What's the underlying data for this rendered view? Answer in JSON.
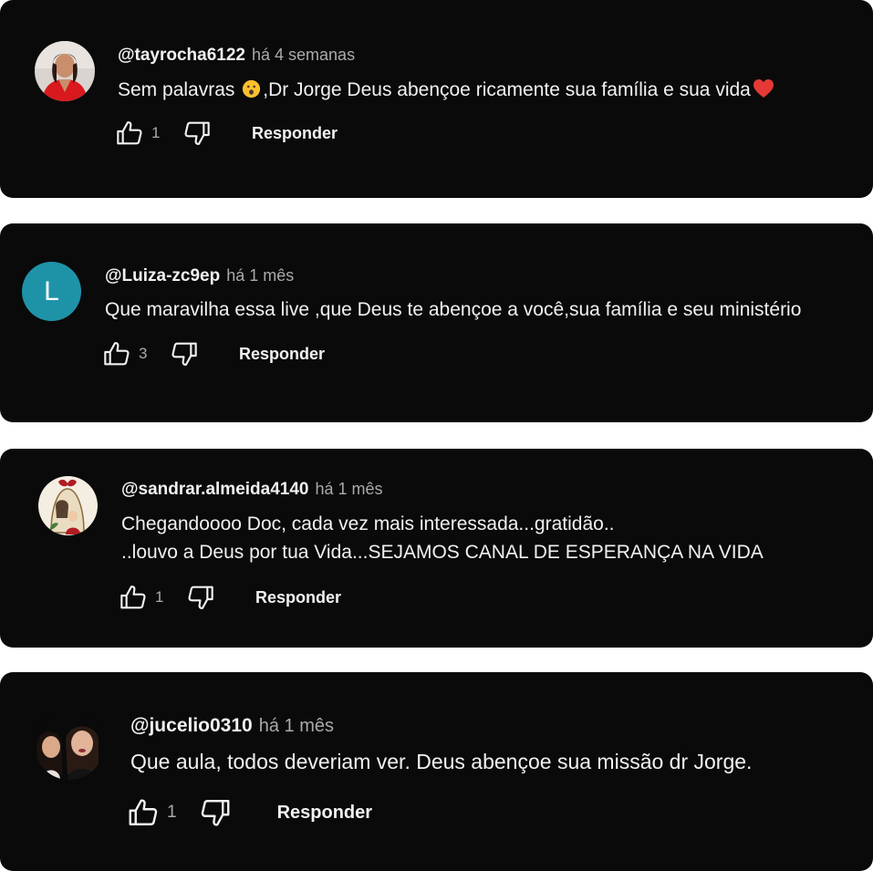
{
  "comments": [
    {
      "handle": "@tayrocha6122",
      "time": "há 4 semanas",
      "text_before_emoji": "Sem palavras ",
      "text_after_emoji": ",Dr Jorge Deus abençoe ricamente sua família e sua vida",
      "likes": "1",
      "reply_label": "Responder",
      "avatar": "photo-woman-red-dress"
    },
    {
      "handle": "@Luiza-zc9ep",
      "time": "há 1 mês",
      "text": "Que maravilha essa live ,que Deus te abençoe a você,sua família e seu ministério",
      "likes": "3",
      "reply_label": "Responder",
      "avatar_letter": "L",
      "avatar_color": "#1e93a8"
    },
    {
      "handle": "@sandrar.almeida4140",
      "time": "há 1 mês",
      "text_lines": [
        "Chegandoooo Doc, cada vez mais interessada...gratidão..",
        "..louvo a Deus por tua Vida...SEJAMOS CANAL DE ESPERANÇA NA VIDA"
      ],
      "likes": "1",
      "reply_label": "Responder",
      "avatar": "illustration-religious-figure"
    },
    {
      "handle": "@jucelio0310",
      "time": "há 1 mês",
      "text": "Que aula, todos deveriam ver. Deus abençoe sua missão dr Jorge.",
      "likes": "1",
      "reply_label": "Responder",
      "avatar": "photo-two-people"
    }
  ],
  "icons": {
    "like": "thumb-up-icon",
    "dislike": "thumb-down-icon",
    "emoji_1": "astonished-face-emoji",
    "emoji_2": "red-heart-emoji"
  },
  "colors": {
    "card_background": "#0a0a0a",
    "text_primary": "#f1f1f1",
    "text_secondary": "#aaaaaa",
    "avatar_letter_bg": "#1e93a8"
  }
}
